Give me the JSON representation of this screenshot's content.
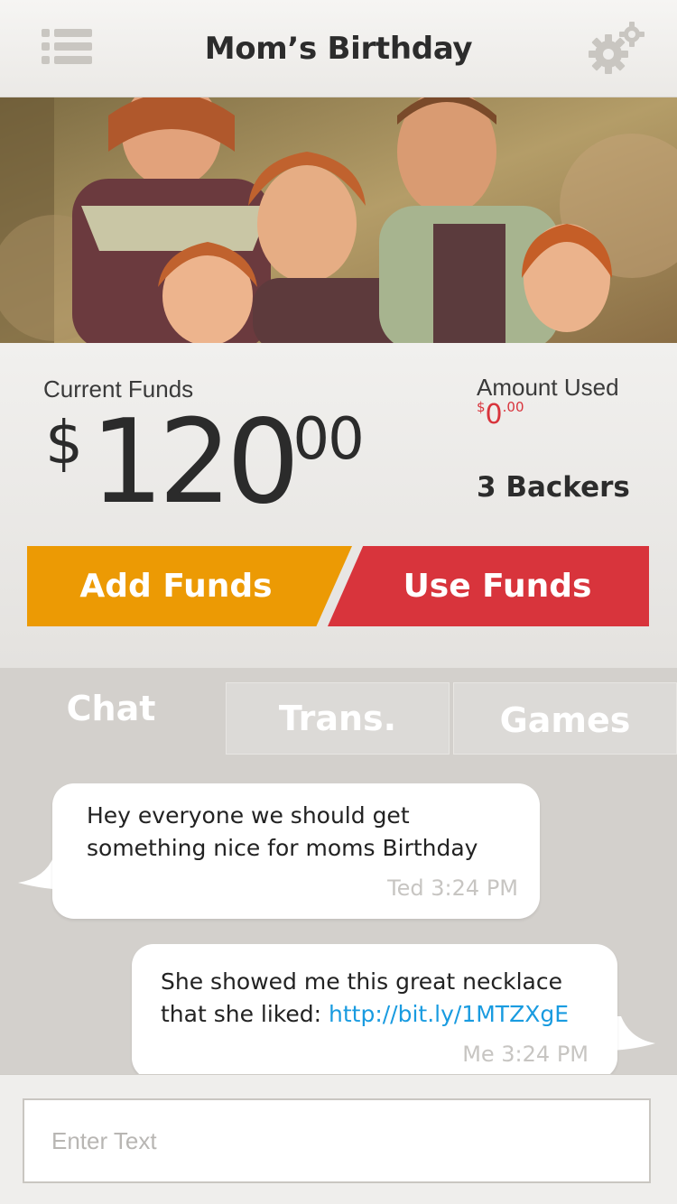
{
  "header": {
    "title": "Mom’s Birthday",
    "menu_icon": "hamburger-menu-icon",
    "settings_icon": "gear-icon"
  },
  "photo": {
    "description_icon": "family-photo"
  },
  "funds": {
    "current_label": "Current Funds",
    "current_currency": "$",
    "current_whole": "120",
    "current_cents": ".00",
    "used_label": "Amount Used",
    "used_currency": "$",
    "used_whole": "0",
    "used_cents": ".00",
    "backers": "3 Backers"
  },
  "actions": {
    "add_label": "Add Funds",
    "use_label": "Use Funds"
  },
  "tabs": [
    {
      "label": "Chat",
      "active": true
    },
    {
      "label": "Trans.",
      "active": false
    },
    {
      "label": "Games",
      "active": false
    }
  ],
  "messages": [
    {
      "text": "Hey everyone we should get something nice for moms Birthday",
      "meta": "Ted 3:24 PM"
    },
    {
      "text": "She showed me this great necklace that she liked: ",
      "link": "http://bit.ly/1MTZXgE",
      "meta": "Me 3:24 PM"
    }
  ],
  "composer": {
    "placeholder": "Enter Text"
  },
  "colors": {
    "add": "#ec9a04",
    "use": "#d8343c",
    "link": "#199be0"
  }
}
